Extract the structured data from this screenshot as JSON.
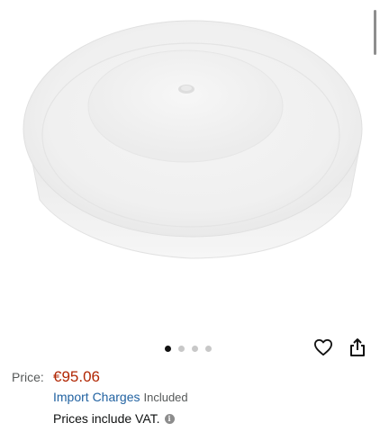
{
  "product": {
    "image_alt": "white round plastic platter cover",
    "carousel": {
      "total": 4,
      "active_index": 0
    }
  },
  "actions": {
    "wishlist_icon": "heart-icon",
    "share_icon": "share-icon"
  },
  "price": {
    "label": "Price:",
    "value": "€95.06",
    "import_link": "Import Charges",
    "import_status": "Included",
    "vat_text": "Prices include VAT.",
    "info_icon": "info-icon"
  },
  "colors": {
    "price": "#b12704",
    "link": "#2162a1",
    "text": "#0f1111",
    "muted": "#565959"
  }
}
